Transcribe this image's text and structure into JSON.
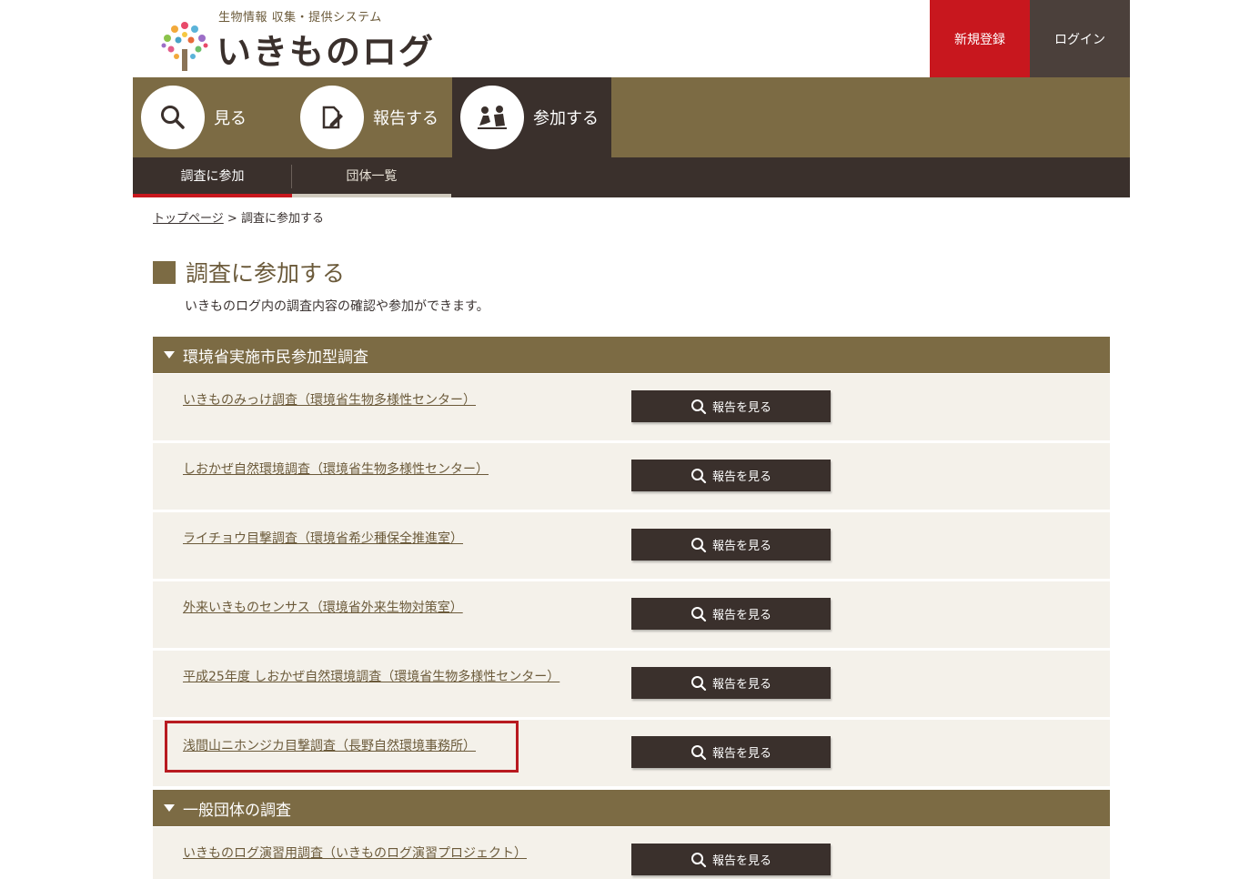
{
  "header": {
    "logo_subtitle": "生物情報 収集・提供システム",
    "logo_title": "いきものログ",
    "register_label": "新規登録",
    "login_label": "ログイン"
  },
  "nav": {
    "look": "見る",
    "report": "報告する",
    "join": "参加する"
  },
  "subnav": {
    "survey": "調査に参加",
    "groups": "団体一覧"
  },
  "breadcrumb": {
    "top": "トップページ",
    "sep": ">",
    "current": "調査に参加する"
  },
  "page": {
    "title": "調査に参加する",
    "description": "いきものログ内の調査内容の確認や参加ができます。"
  },
  "sections": [
    {
      "title": "環境省実施市民参加型調査",
      "items": [
        {
          "label": "いきものみっけ調査（環境省生物多様性センター）",
          "button": "報告を見る"
        },
        {
          "label": "しおかぜ自然環境調査（環境省生物多様性センター）",
          "button": "報告を見る"
        },
        {
          "label": "ライチョウ目撃調査（環境省希少種保全推進室）",
          "button": "報告を見る"
        },
        {
          "label": "外来いきものセンサス（環境省外来生物対策室）",
          "button": "報告を見る"
        },
        {
          "label": "平成25年度 しおかぜ自然環境調査（環境省生物多様性センター）",
          "button": "報告を見る"
        },
        {
          "label": "浅間山ニホンジカ目撃調査（長野自然環境事務所）",
          "button": "報告を見る"
        }
      ]
    },
    {
      "title": "一般団体の調査",
      "items": [
        {
          "label": "いきものログ演習用調査（いきものログ演習プロジェクト）",
          "button": "報告を見る"
        }
      ]
    }
  ],
  "colors": {
    "brand_brown": "#7c6b44",
    "dark": "#3a302c",
    "red": "#c8171e",
    "row_bg": "#f4f1ea"
  }
}
